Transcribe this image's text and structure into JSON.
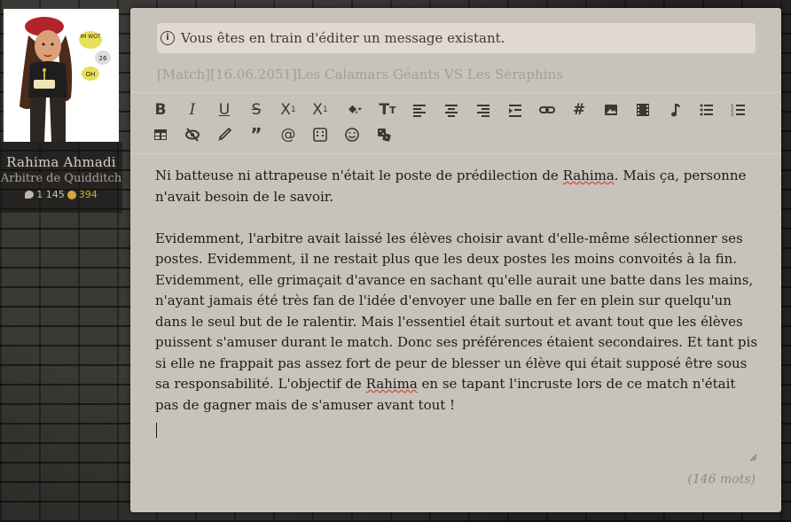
{
  "profile": {
    "name": "Rahima Ahmadi",
    "role": "Arbitre de Quidditch",
    "messages": "1 145",
    "gold": "394",
    "avatar_bubbles": [
      "IM WOT",
      "26",
      "OH"
    ]
  },
  "editor": {
    "notice": "Vous êtes en train d'éditer un message existant.",
    "subject": "[Match][16.06.2051]Les Calamars Géants VS Les Séraphins",
    "toolbar_row1": [
      "bold-icon",
      "italic-icon",
      "underline-icon",
      "strikethrough-icon",
      "subscript-icon",
      "superscript-icon",
      "fill-color-icon",
      "text-size-icon",
      "align-left-icon",
      "align-center-icon",
      "align-right-icon",
      "indent-icon",
      "link-icon",
      "hashtag-icon",
      "image-icon",
      "video-icon",
      "music-icon",
      "bullet-list-icon",
      "numbered-list-icon"
    ],
    "toolbar_row2": [
      "table-icon",
      "hide-icon",
      "brush-icon",
      "quote-icon",
      "mention-icon",
      "code-block-icon",
      "emoji-icon",
      "dice-icon"
    ],
    "paragraph1_a": "Ni batteuse ni attrapeuse n'était le poste de prédilection de ",
    "paragraph1_name": "Rahima",
    "paragraph1_b": ". Mais ça, personne n'avait besoin de le savoir.",
    "paragraph2_a": "Evidemment, l'arbitre avait laissé les élèves choisir avant d'elle-même sélectionner ses postes. Evidemment, il ne restait plus que les deux postes les moins convoités à la fin. Evidemment, elle grimaçait d'avance en sachant qu'elle aurait une batte dans les mains, n'ayant jamais été très fan de l'idée d'envoyer une balle en fer en plein sur quelqu'un dans le seul but de le ralentir. Mais l'essentiel était surtout et avant tout que les élèves puissent s'amuser durant le match. Donc ses préférences étaient secondaires. Et tant pis si elle ne frappait pas assez fort de peur de blesser un élève qui était supposé être sous sa responsabilité. L'objectif de ",
    "paragraph2_name": "Rahima",
    "paragraph2_b": " en se tapant l'incruste lors de ce match n'était pas de gagner mais de s'amuser avant tout !",
    "word_count": "(146 mots)"
  },
  "colors": {
    "panel_bg": "#c7c2ba",
    "notice_bg": "#e1d9d0",
    "gold": "#d3a83d",
    "spell_error": "#d2302c"
  }
}
